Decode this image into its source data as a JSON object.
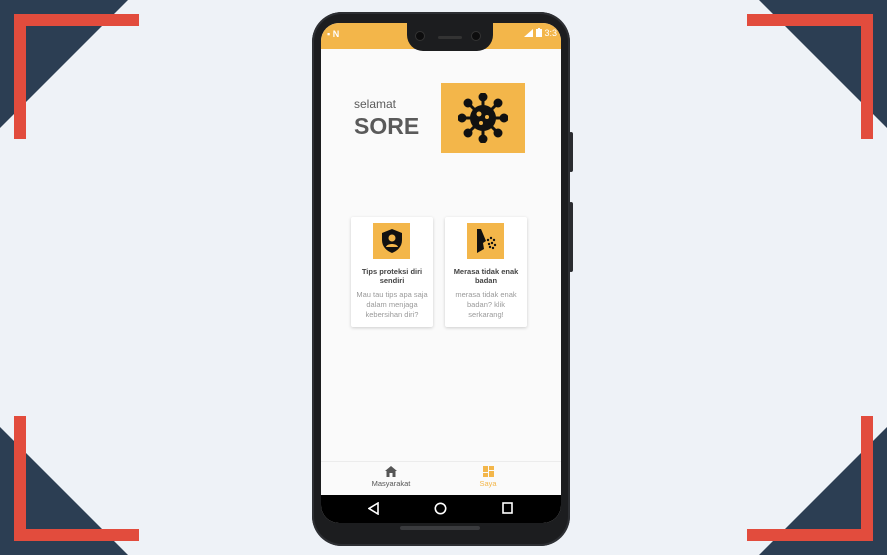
{
  "colors": {
    "accent": "#f3b64a",
    "frame_dark": "#2c3e53",
    "frame_red": "#e24c3d",
    "active_nav": "#f3b64a",
    "inactive_nav": "#555555"
  },
  "statusbar": {
    "left_icons": "▪ N",
    "time": "3:3"
  },
  "greeting": {
    "small": "selamat",
    "big": "SORE"
  },
  "hero": {
    "icon": "virus-icon"
  },
  "cards": [
    {
      "icon": "shield-user-icon",
      "title": "Tips proteksi diri sendiri",
      "desc": "Mau tau tips apa saja dalam menjaga kebersihan diri?"
    },
    {
      "icon": "sneeze-icon",
      "title": "Merasa tidak enak badan",
      "desc": "merasa tidak enak badan? klik serkarang!"
    }
  ],
  "bottom_nav": {
    "items": [
      {
        "label": "Masyarakat",
        "icon": "home-icon",
        "active": false
      },
      {
        "label": "Saya",
        "icon": "grid-icon",
        "active": true
      }
    ]
  },
  "system_nav": {
    "icons": [
      "back-icon",
      "home-circle-icon",
      "recents-icon"
    ]
  }
}
